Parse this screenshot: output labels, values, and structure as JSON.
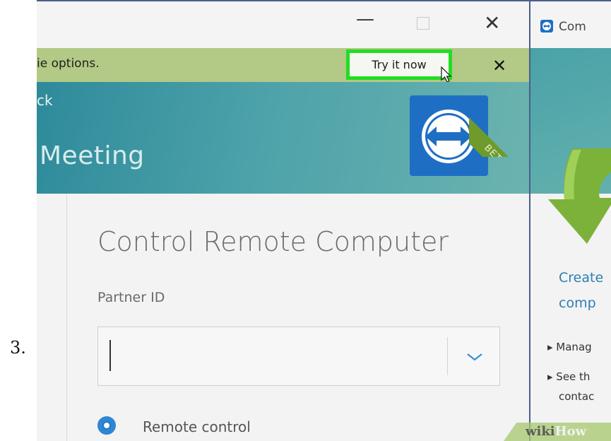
{
  "step_number": "3.",
  "window": {
    "minimize_glyph": "—",
    "close_glyph": "✕"
  },
  "notification": {
    "text": "ie options.",
    "button_label": "Try it now",
    "close_glyph": "✕"
  },
  "banner": {
    "back_label": "ck",
    "title": "Meeting",
    "beta_label": "BETA"
  },
  "main": {
    "section_title": "Control Remote Computer",
    "partner_label": "Partner ID",
    "partner_value": "",
    "radio_label": "Remote control"
  },
  "second_window": {
    "title": "Com",
    "text_line1": "Create",
    "text_line2": "comp",
    "bullet1": "▸ Manag",
    "bullet2": "▸ See th",
    "bullet2_cont": "contac"
  },
  "watermark": {
    "wiki": "wiki",
    "how": "How"
  },
  "colors": {
    "highlight": "#22dd22",
    "notification_bar": "#b3c986",
    "brand_blue": "#1e6fc4",
    "link_blue": "#2d7fb3"
  }
}
